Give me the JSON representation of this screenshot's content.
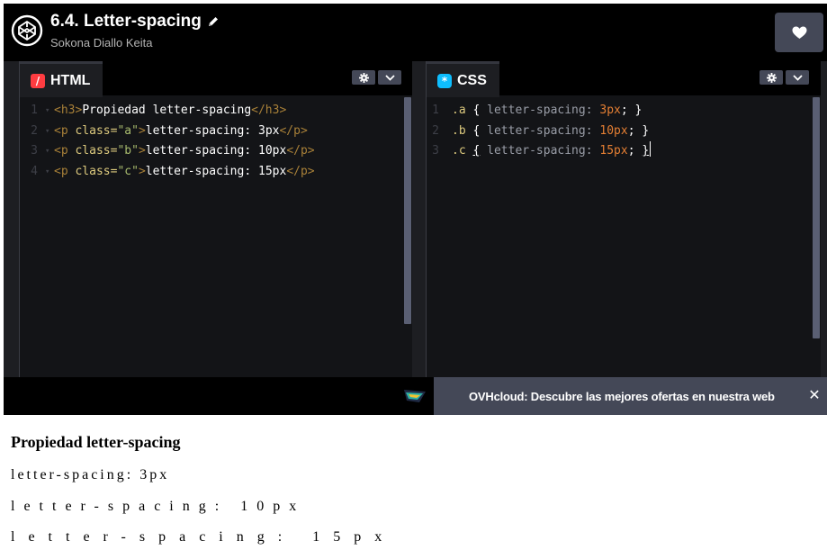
{
  "header": {
    "title": "6.4. Letter-spacing",
    "author": "Sokona Diallo Keita",
    "icons": {
      "logo": "codepen-logo-icon",
      "edit": "pencil-icon",
      "like": "heart-icon"
    }
  },
  "editors": {
    "html": {
      "tab_label": "HTML",
      "icon_glyph": "/",
      "icon_color": "#ff3c41",
      "line_numbers": [
        "1",
        "2",
        "3",
        "4"
      ],
      "lines": [
        {
          "open": "<h3>",
          "text": "Propiedad letter-spacing",
          "close": "</h3>"
        },
        {
          "open_start": "<p ",
          "attr": "class=",
          "value": "\"a\"",
          "open_end": ">",
          "text": "letter-spacing: 3px",
          "close": "</p>"
        },
        {
          "open_start": "<p ",
          "attr": "class=",
          "value": "\"b\"",
          "open_end": ">",
          "text": "letter-spacing: 10px",
          "close": "</p>"
        },
        {
          "open_start": "<p ",
          "attr": "class=",
          "value": "\"c\"",
          "open_end": ">",
          "text": "letter-spacing: 15px",
          "close": "</p>"
        }
      ]
    },
    "css": {
      "tab_label": "CSS",
      "icon_glyph": "*",
      "icon_color": "#0ebeff",
      "line_numbers": [
        "1",
        "2",
        "3"
      ],
      "lines": [
        {
          "selector": ".a",
          "open": "{",
          "prop": "letter-spacing:",
          "value": "3px",
          "end": ";",
          "close": "}"
        },
        {
          "selector": ".b",
          "open": "{",
          "prop": "letter-spacing:",
          "value": "10px",
          "end": ";",
          "close": "}"
        },
        {
          "selector": ".c",
          "open": "{",
          "prop": "letter-spacing:",
          "value": "15px",
          "end": ";",
          "close": "}"
        }
      ]
    }
  },
  "ad": {
    "text": "OVHcloud: Descubre las mejores ofertas en nuestra web",
    "close_glyph": "✕"
  },
  "preview": {
    "heading": "Propiedad letter-spacing",
    "para_a": "letter-spacing: 3px",
    "para_b": "letter-spacing: 10px",
    "para_c": "letter-spacing: 15px"
  }
}
